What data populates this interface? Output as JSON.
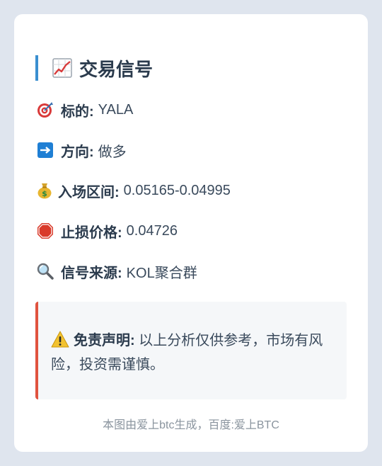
{
  "title": "交易信号",
  "rows": {
    "target": {
      "label": "标的:",
      "value": "YALA",
      "icon": "target-icon"
    },
    "direction": {
      "label": "方向:",
      "value": "做多",
      "icon": "right-arrow-icon"
    },
    "entry": {
      "label": "入场区间:",
      "value": "0.05165-0.04995",
      "icon": "money-bag-icon"
    },
    "stop": {
      "label": "止损价格:",
      "value": "0.04726",
      "icon": "stop-sign-icon"
    },
    "source": {
      "label": "信号来源:",
      "value": "KOL聚合群",
      "icon": "magnifier-icon"
    }
  },
  "disclaimer": {
    "label": "免责声明:",
    "text": "以上分析仅供参考，市场有风险，投资需谨慎。",
    "icon": "warning-icon"
  },
  "footer": "本图由爱上btc生成，百度:爱上BTC",
  "colors": {
    "background": "#dfe5ee",
    "card": "#ffffff",
    "title_accent": "#3a8fd0",
    "warning_accent": "#e0533f"
  }
}
